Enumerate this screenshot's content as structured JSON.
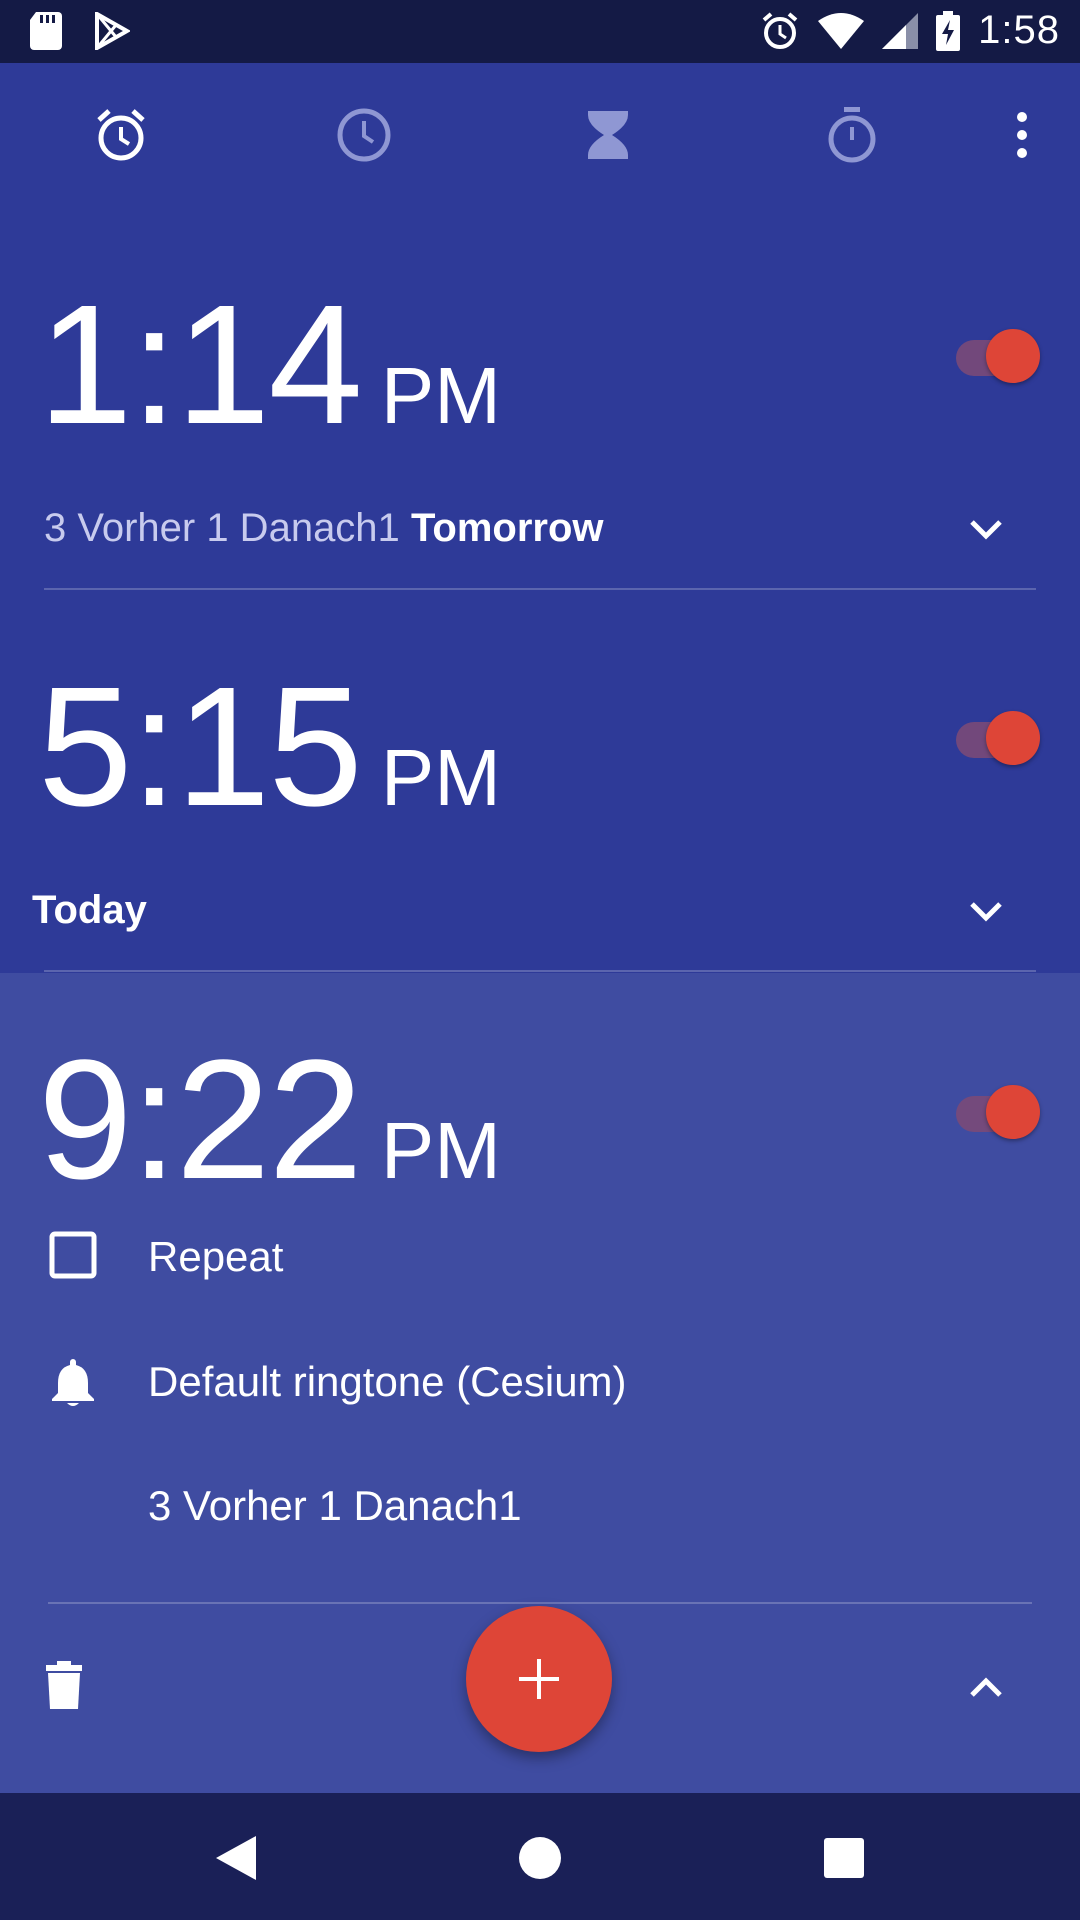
{
  "status_bar": {
    "time": "1:58",
    "icons": [
      "sd-card-icon",
      "play-store-icon",
      "alarm-icon",
      "wifi-icon",
      "signal-icon",
      "battery-charging-icon"
    ]
  },
  "tabs": [
    {
      "name": "alarm-tab",
      "icon": "alarm-icon",
      "active": true
    },
    {
      "name": "clock-tab",
      "icon": "clock-icon",
      "active": false
    },
    {
      "name": "timer-tab",
      "icon": "hourglass-icon",
      "active": false
    },
    {
      "name": "stopwatch-tab",
      "icon": "stopwatch-icon",
      "active": false
    }
  ],
  "alarms": [
    {
      "time": "1:14",
      "ampm": "PM",
      "enabled": true,
      "label": "3 Vorher 1 Danach1",
      "day": "Tomorrow"
    },
    {
      "time": "5:15",
      "ampm": "PM",
      "enabled": true,
      "label": "",
      "day": "Today"
    },
    {
      "time": "9:22",
      "ampm": "PM",
      "enabled": true,
      "repeat_label": "Repeat",
      "ringtone": "Default ringtone (Cesium)",
      "label": "3 Vorher 1 Danach1"
    }
  ],
  "fab": {
    "icon": "plus-icon"
  },
  "colors": {
    "background": "#2e3a98",
    "expanded_background": "#3f4ca1",
    "accent": "#de4537",
    "status_bar": "#141a45",
    "nav_bar": "#1a2057"
  }
}
